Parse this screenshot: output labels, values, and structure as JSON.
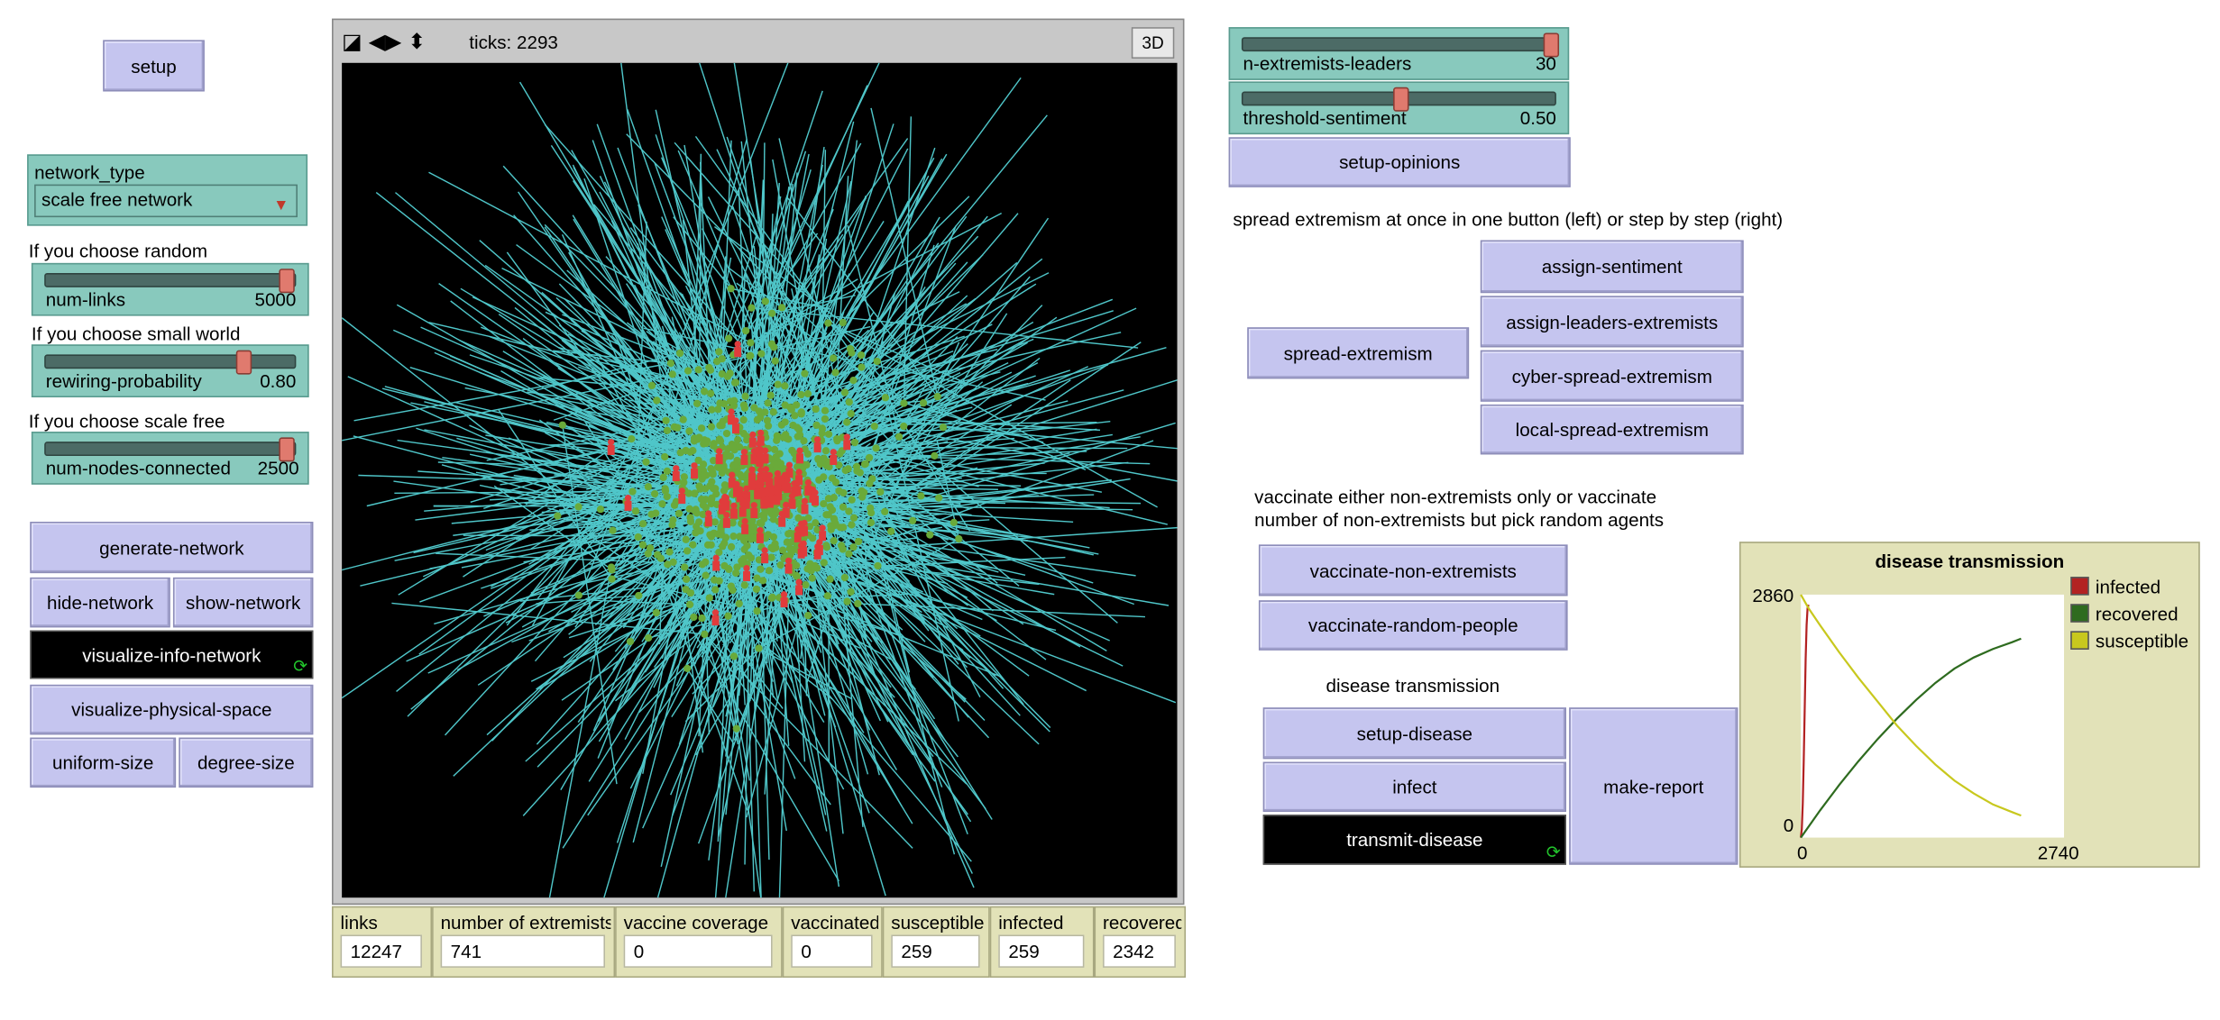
{
  "buttons": {
    "setup": "setup",
    "generate_network": "generate-network",
    "hide_network": "hide-network",
    "show_network": "show-network",
    "visualize_info_network": "visualize-info-network",
    "visualize_physical_space": "visualize-physical-space",
    "uniform_size": "uniform-size",
    "degree_size": "degree-size",
    "setup_opinions": "setup-opinions",
    "spread_extremism": "spread-extremism",
    "assign_sentiment": "assign-sentiment",
    "assign_leaders_extremists": "assign-leaders-extremists",
    "cyber_spread_extremism": "cyber-spread-extremism",
    "local_spread_extremism": "local-spread-extremism",
    "vaccinate_non_extremists": "vaccinate-non-extremists",
    "vaccinate_random_people": "vaccinate-random-people",
    "setup_disease": "setup-disease",
    "infect": "infect",
    "transmit_disease": "transmit-disease",
    "make_report": "make-report"
  },
  "chooser": {
    "label": "network_type",
    "value": "scale free network"
  },
  "notes": {
    "random": "If you choose random",
    "small_world": "If you choose small world",
    "scale_free": "If you choose scale free",
    "spread": "spread extremism at once in one button (left) or step by step (right)",
    "vaccinate_line1": "vaccinate either non-extremists only or vaccinate",
    "vaccinate_line2": "number of non-extremists but pick random agents",
    "disease": "disease transmission"
  },
  "sliders": {
    "num_links": {
      "label": "num-links",
      "value": "5000",
      "fraction": 0.98
    },
    "rewiring_probability": {
      "label": "rewiring-probability",
      "value": "0.80",
      "fraction": 0.8
    },
    "num_nodes_connected": {
      "label": "num-nodes-connected",
      "value": "2500",
      "fraction": 0.98
    },
    "n_extremists_leaders": {
      "label": "n-extremists-leaders",
      "value": "30",
      "fraction": 1.0
    },
    "threshold_sentiment": {
      "label": "threshold-sentiment",
      "value": "0.50",
      "fraction": 0.5
    }
  },
  "view": {
    "ticks_label": "ticks: 2293",
    "button_3d": "3D"
  },
  "monitors": {
    "links": {
      "label": "links",
      "value": "12247"
    },
    "extremists": {
      "label": "number of extremists",
      "value": "741"
    },
    "vaccine_coverage": {
      "label": "vaccine coverage",
      "value": "0"
    },
    "vaccinated": {
      "label": "vaccinated",
      "value": "0"
    },
    "susceptible": {
      "label": "susceptible",
      "value": "259"
    },
    "infected": {
      "label": "infected",
      "value": "259"
    },
    "recovered": {
      "label": "recovered",
      "value": "2342"
    }
  },
  "colors": {
    "button": "#c5c5ef",
    "slider": "#88c9bd",
    "monitor": "#e2e2b8",
    "world_bg": "#000000",
    "link": "#4fc6c9",
    "turtle": "#6aaa3a",
    "extremist": "#e03c3c"
  },
  "chart_data": {
    "type": "line",
    "title": "disease transmission",
    "xlim": [
      0,
      2740
    ],
    "ylim": [
      0,
      2860
    ],
    "x_tick_labels": [
      "0",
      "2740"
    ],
    "y_tick_labels": [
      "0",
      "2860"
    ],
    "legend_placement": "right",
    "series": [
      {
        "name": "infected",
        "color": "#b22222",
        "x": [
          0,
          10,
          20,
          30,
          40,
          50,
          60,
          70,
          80
        ],
        "y": [
          0,
          100,
          400,
          900,
          1500,
          2100,
          2500,
          2700,
          2740
        ]
      },
      {
        "name": "recovered",
        "color": "#2e6b1f",
        "x": [
          0,
          100,
          200,
          400,
          600,
          800,
          1000,
          1200,
          1400,
          1600,
          1800,
          2000,
          2200,
          2293
        ],
        "y": [
          0,
          160,
          320,
          620,
          900,
          1160,
          1400,
          1620,
          1820,
          1990,
          2120,
          2220,
          2300,
          2342
        ]
      },
      {
        "name": "susceptible",
        "color": "#c8c81e",
        "x": [
          0,
          20,
          80,
          200,
          400,
          600,
          800,
          1000,
          1200,
          1400,
          1600,
          1800,
          2000,
          2200,
          2293
        ],
        "y": [
          2860,
          2820,
          2700,
          2500,
          2180,
          1880,
          1600,
          1320,
          1080,
          860,
          670,
          520,
          390,
          300,
          259
        ]
      }
    ]
  }
}
